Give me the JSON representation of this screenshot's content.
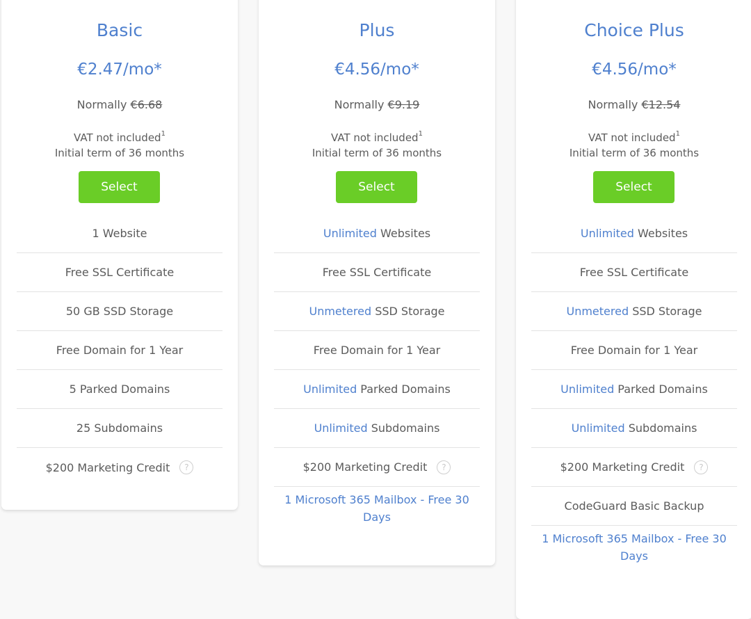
{
  "colors": {
    "accent": "#4f80ce",
    "button": "#6acd27",
    "text": "#5b5b5b",
    "background": "#f8f8f8"
  },
  "plans": [
    {
      "name": "Basic",
      "price": "€2.47/mo*",
      "normally_label": "Normally",
      "normal_price": "€6.68",
      "vat": "VAT not included",
      "vat_footnote": "1",
      "term": "Initial term of 36 months",
      "select_label": "Select",
      "features": [
        {
          "highlight": "",
          "text": "1 Website"
        },
        {
          "highlight": "",
          "text": "Free SSL Certificate"
        },
        {
          "highlight": "",
          "text": "50 GB SSD Storage"
        },
        {
          "highlight": "",
          "text": "Free Domain for 1 Year"
        },
        {
          "highlight": "",
          "text": "5 Parked Domains"
        },
        {
          "highlight": "",
          "text": "25 Subdomains"
        },
        {
          "highlight": "",
          "text": "$200 Marketing Credit",
          "help_icon": "?"
        }
      ]
    },
    {
      "name": "Plus",
      "price": "€4.56/mo*",
      "normally_label": "Normally",
      "normal_price": "€9.19",
      "vat": "VAT not included",
      "vat_footnote": "1",
      "term": "Initial term of 36 months",
      "select_label": "Select",
      "features": [
        {
          "highlight": "Unlimited",
          "text": " Websites"
        },
        {
          "highlight": "",
          "text": "Free SSL Certificate"
        },
        {
          "highlight": "Unmetered",
          "text": " SSD Storage"
        },
        {
          "highlight": "",
          "text": "Free Domain for 1 Year"
        },
        {
          "highlight": "Unlimited",
          "text": " Parked Domains"
        },
        {
          "highlight": "Unlimited",
          "text": " Subdomains"
        },
        {
          "highlight": "",
          "text": "$200 Marketing Credit",
          "help_icon": "?"
        },
        {
          "highlight": "1 Microsoft 365 Mailbox - Free 30 Days",
          "text": ""
        }
      ]
    },
    {
      "name": "Choice Plus",
      "price": "€4.56/mo*",
      "normally_label": "Normally",
      "normal_price": "€12.54",
      "vat": "VAT not included",
      "vat_footnote": "1",
      "term": "Initial term of 36 months",
      "select_label": "Select",
      "features": [
        {
          "highlight": "Unlimited",
          "text": " Websites"
        },
        {
          "highlight": "",
          "text": "Free SSL Certificate"
        },
        {
          "highlight": "Unmetered",
          "text": " SSD Storage"
        },
        {
          "highlight": "",
          "text": "Free Domain for 1 Year"
        },
        {
          "highlight": "Unlimited",
          "text": " Parked Domains"
        },
        {
          "highlight": "Unlimited",
          "text": " Subdomains"
        },
        {
          "highlight": "",
          "text": "$200 Marketing Credit",
          "help_icon": "?"
        },
        {
          "highlight": "",
          "text": "CodeGuard Basic Backup"
        },
        {
          "highlight": "1 Microsoft 365 Mailbox - Free 30 Days",
          "text": ""
        }
      ]
    }
  ]
}
